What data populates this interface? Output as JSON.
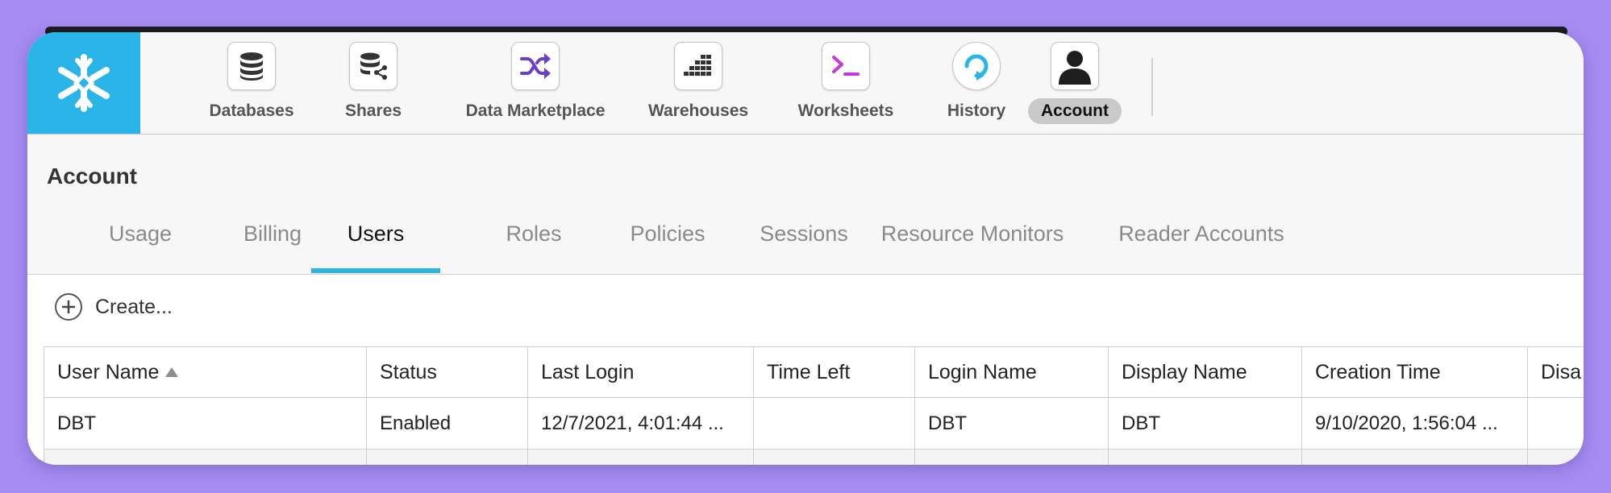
{
  "colors": {
    "accent": "#29b5e8",
    "background": "#a48cf2"
  },
  "nav": {
    "logo": "snowflake-icon",
    "items": [
      {
        "label": "Databases",
        "icon": "database-icon"
      },
      {
        "label": "Shares",
        "icon": "shares-icon"
      },
      {
        "label": "Data Marketplace",
        "icon": "shuffle-icon"
      },
      {
        "label": "Warehouses",
        "icon": "warehouses-icon"
      },
      {
        "label": "Worksheets",
        "icon": "terminal-icon"
      },
      {
        "label": "History",
        "icon": "history-icon"
      },
      {
        "label": "Account",
        "icon": "user-icon",
        "active": true
      }
    ]
  },
  "page": {
    "title": "Account",
    "tabs": [
      {
        "label": "Usage"
      },
      {
        "label": "Billing"
      },
      {
        "label": "Users",
        "active": true
      },
      {
        "label": "Roles"
      },
      {
        "label": "Policies"
      },
      {
        "label": "Sessions"
      },
      {
        "label": "Resource Monitors"
      },
      {
        "label": "Reader Accounts"
      }
    ],
    "create_label": "Create..."
  },
  "table": {
    "columns": [
      "User Name",
      "Status",
      "Last Login",
      "Time Left",
      "Login Name",
      "Display Name",
      "Creation Time",
      "Disa"
    ],
    "sorted_column": "User Name",
    "rows": [
      [
        "DBT",
        "Enabled",
        "12/7/2021, 4:01:44 ...",
        "",
        "DBT",
        "DBT",
        "9/10/2020, 1:56:04 ...",
        ""
      ]
    ]
  }
}
